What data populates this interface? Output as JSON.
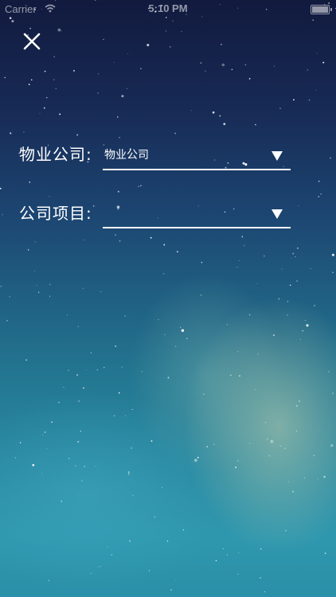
{
  "status_bar": {
    "carrier": "Carrier",
    "wifi_icon": "wifi-icon",
    "time": "5:10 PM",
    "battery_level": 1.0
  },
  "header": {
    "close_icon": "close-icon"
  },
  "form": {
    "company": {
      "label": "物业公司:",
      "value": "物业公司",
      "icon": "chevron-down-icon"
    },
    "project": {
      "label": "公司项目:",
      "value": "",
      "icon": "chevron-down-icon"
    }
  },
  "colors": {
    "text": "#ffffff",
    "underline": "#ffffff",
    "background_top": "#121a3e",
    "background_bottom": "#2a8fa8"
  }
}
